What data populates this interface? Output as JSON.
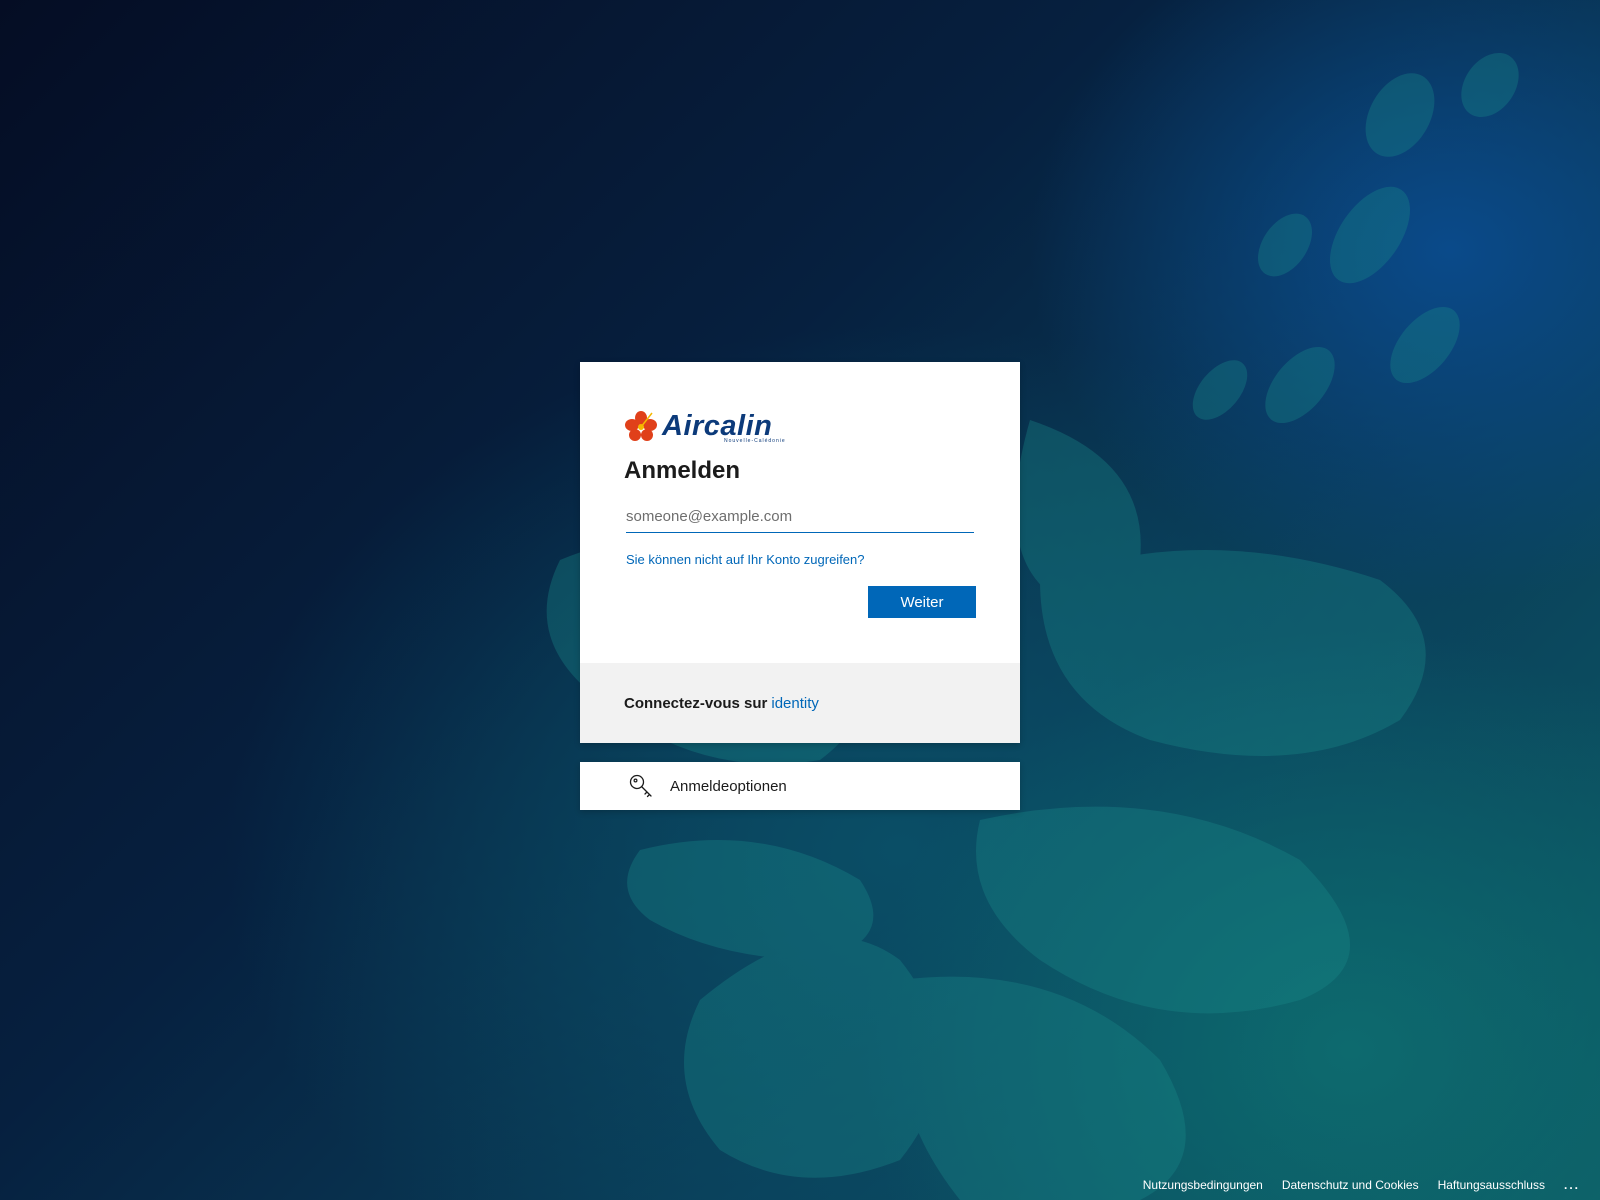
{
  "brand": {
    "name": "Aircalin",
    "subtitle": "Nouvelle-Calédonie"
  },
  "signin": {
    "title": "Anmelden",
    "email_placeholder": "someone@example.com",
    "email_value": "",
    "cant_access_link": "Sie können nicht auf Ihr Konto zugreifen?",
    "next_label": "Weiter"
  },
  "card_footer": {
    "prefix": "Connectez-vous sur",
    "link": "identity"
  },
  "options": {
    "label": "Anmeldeoptionen",
    "icon": "key-icon"
  },
  "page_footer": {
    "terms": "Nutzungsbedingungen",
    "privacy": "Datenschutz und Cookies",
    "disclaimer": "Haftungsausschluss",
    "more": "..."
  },
  "colors": {
    "accent": "#0067b8",
    "brand_blue": "#0c3a7a",
    "brand_red": "#e0401a"
  }
}
